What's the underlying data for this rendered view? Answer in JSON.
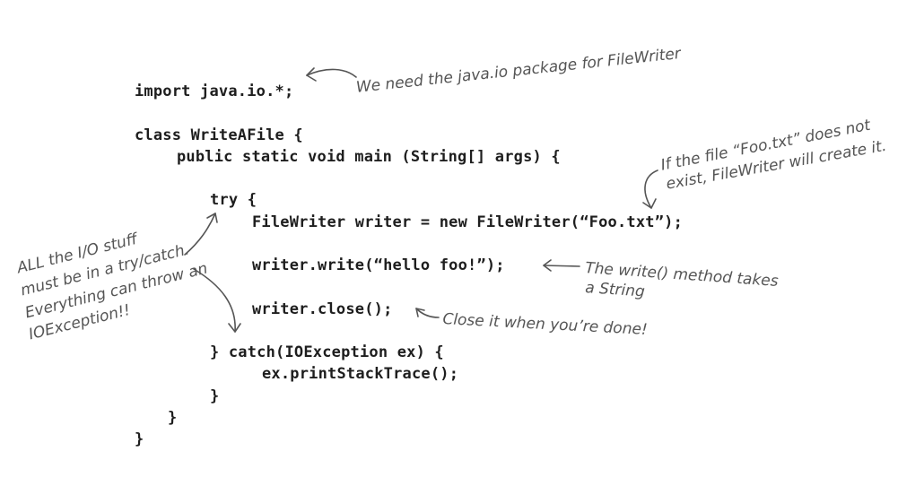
{
  "code": {
    "lines": [
      "import java.io.*;",
      "class WriteAFile {",
      "public static void main (String[] args) {",
      "try {",
      "FileWriter writer = new FileWriter(“Foo.txt”);",
      "writer.write(“hello foo!”);",
      "writer.close();",
      "} catch(IOException ex) {",
      "ex.printStackTrace();",
      "}",
      "}",
      "}"
    ]
  },
  "annotations": {
    "import_note": "We need the java.io package for FileWriter",
    "file_note_line1": "If the file “Foo.txt” does not",
    "file_note_line2": "exist, FileWriter will create it.",
    "write_note_line1": "The write() method takes",
    "write_note_line2": "a String",
    "close_note": "Close it when you’re done!",
    "io_note_line1": "ALL the I/O stuff",
    "io_note_line2": "must be in a try/catch.",
    "io_note_line3": "Everything can throw an",
    "io_note_line4": "IOException!!"
  }
}
